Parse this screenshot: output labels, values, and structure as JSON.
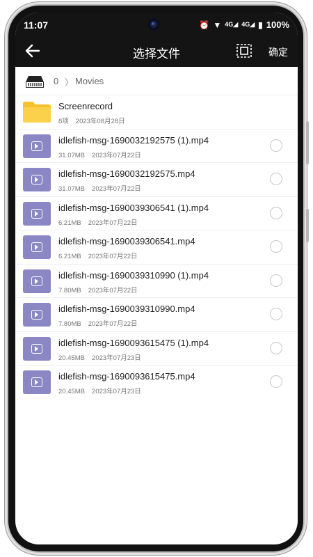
{
  "status_bar": {
    "time": "11:07",
    "network": "4G",
    "battery": "100%"
  },
  "app_bar": {
    "title": "选择文件",
    "confirm_label": "确定"
  },
  "breadcrumb": {
    "root": "0",
    "current": "Movies"
  },
  "folder": {
    "name": "Screenrecord",
    "count": "8项",
    "date": "2023年08月28日"
  },
  "files": [
    {
      "name": "idlefish-msg-1690032192575 (1).mp4",
      "size": "31.07MB",
      "date": "2023年07月22日"
    },
    {
      "name": "idlefish-msg-1690032192575.mp4",
      "size": "31.07MB",
      "date": "2023年07月22日"
    },
    {
      "name": "idlefish-msg-1690039306541 (1).mp4",
      "size": "6.21MB",
      "date": "2023年07月22日"
    },
    {
      "name": "idlefish-msg-1690039306541.mp4",
      "size": "6.21MB",
      "date": "2023年07月22日"
    },
    {
      "name": "idlefish-msg-1690039310990 (1).mp4",
      "size": "7.80MB",
      "date": "2023年07月22日"
    },
    {
      "name": "idlefish-msg-1690039310990.mp4",
      "size": "7.80MB",
      "date": "2023年07月22日"
    },
    {
      "name": "idlefish-msg-1690093615475 (1).mp4",
      "size": "20.45MB",
      "date": "2023年07月23日"
    },
    {
      "name": "idlefish-msg-1690093615475.mp4",
      "size": "20.45MB",
      "date": "2023年07月23日"
    }
  ],
  "colors": {
    "bar": "#141414",
    "video_icon": "#8b86c4",
    "folder": "#f7c12e"
  }
}
